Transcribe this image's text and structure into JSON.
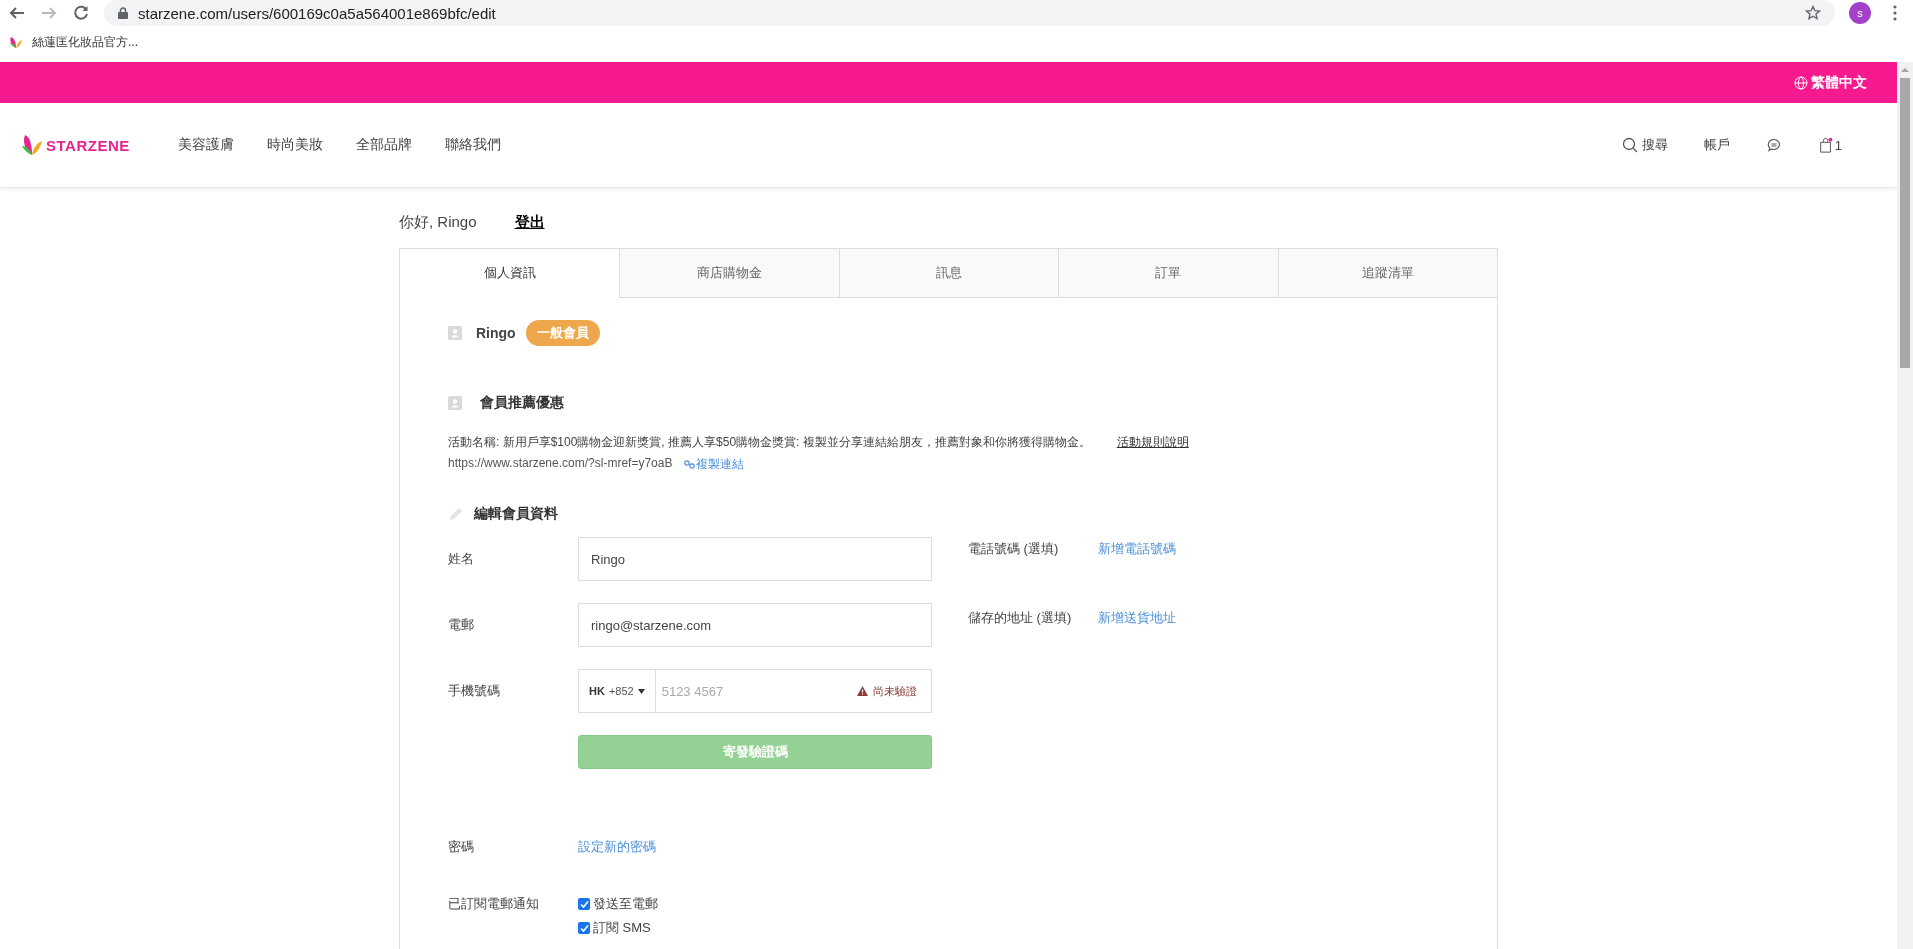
{
  "browser": {
    "url": "starzene.com/users/600169c0a5a564001e869bfc/edit",
    "bookmark": "絲蓮匡化妝品官方...",
    "profile_initial": "s"
  },
  "topbar": {
    "language": "繁體中文"
  },
  "header": {
    "brand": "STARZENE",
    "nav": [
      "美容護膚",
      "時尚美妝",
      "全部品牌",
      "聯絡我們"
    ],
    "search": "搜尋",
    "account": "帳戶",
    "cart_count": "1"
  },
  "greeting": {
    "text": "你好, Ringo",
    "logout": "登出"
  },
  "tabs": [
    {
      "label": "個人資訊",
      "selected": true
    },
    {
      "label": "商店購物金",
      "selected": false
    },
    {
      "label": "訊息",
      "selected": false
    },
    {
      "label": "訂單",
      "selected": false
    },
    {
      "label": "追蹤清單",
      "selected": false
    }
  ],
  "profile": {
    "name": "Ringo",
    "badge": "一般會員"
  },
  "referral": {
    "title": "會員推薦優惠",
    "description": "活動名稱: 新用戶享$100購物金迎新獎賞, 推薦人享$50購物金獎賞: 複製並分享連結給朋友，推薦對象和你將獲得購物金。",
    "rules_link": "活動規則說明",
    "url": "https://www.starzene.com/?sl-mref=y7oaB",
    "copy_link": "複製連結"
  },
  "edit_form": {
    "title": "編輯會員資料",
    "name": {
      "label": "姓名",
      "value": "Ringo"
    },
    "email": {
      "label": "電郵",
      "value": "ringo@starzene.com"
    },
    "mobile": {
      "label": "手機號碼",
      "country": "HK",
      "code": "+852",
      "placeholder": "5123 4567",
      "status": "尚未驗證"
    },
    "send_code_button": {
      "label": "寄發驗證碼",
      "disabled": true
    },
    "optional": [
      {
        "label": "電話號碼 (選填)",
        "link": "新增電話號碼"
      },
      {
        "label": "儲存的地址 (選填)",
        "link": "新增送貨地址"
      }
    ],
    "password": {
      "label": "密碼",
      "link": "設定新的密碼"
    },
    "subscriptions": {
      "label": "已訂閱電郵通知",
      "options": [
        {
          "label": "發送至電郵",
          "checked": true
        },
        {
          "label": "訂閱 SMS",
          "checked": true
        }
      ]
    }
  }
}
